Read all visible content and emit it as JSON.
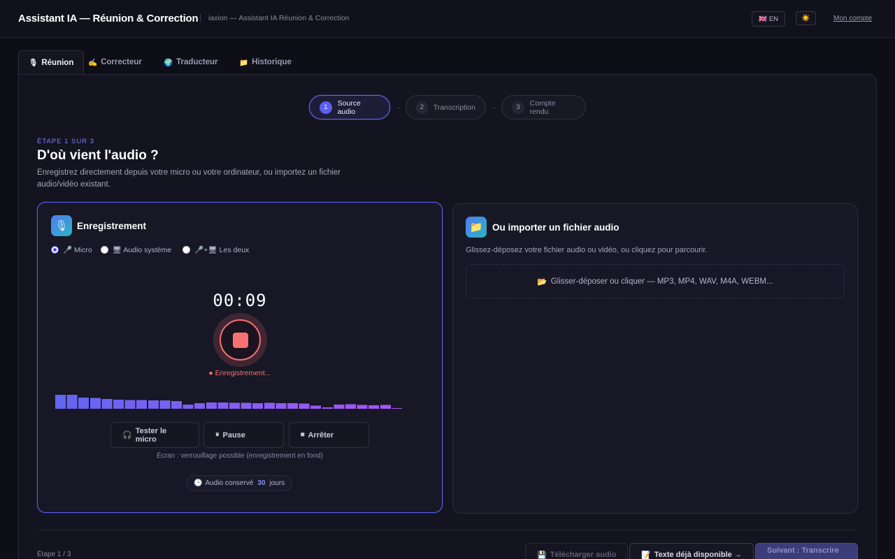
{
  "header": {
    "title": "Assistant IA — Réunion & Correction",
    "subtitle": "iaxion — Assistant IA Réunion & Correction",
    "lang_flag": "🇬🇧",
    "lang_label": "EN",
    "theme_icon": "☀️",
    "account_label": "Mon compte"
  },
  "tabs": [
    {
      "icon": "🎙",
      "label": "Réunion",
      "active": true
    },
    {
      "icon": "✍️",
      "label": "Correcteur",
      "active": false
    },
    {
      "icon": "🌍",
      "label": "Traducteur",
      "active": false
    },
    {
      "icon": "📁",
      "label": "Historique",
      "active": false
    }
  ],
  "stepper": {
    "steps": [
      {
        "num": "1",
        "label": "Source audio",
        "active": true
      },
      {
        "num": "2",
        "label": "Transcription",
        "active": false
      },
      {
        "num": "3",
        "label": "Compte rendu",
        "active": false
      }
    ],
    "arrow": "→"
  },
  "step": {
    "eyebrow": "ÉTAPE 1 SUR 3",
    "title": "D'où vient l'audio ?",
    "description": "Enregistrez directement depuis votre micro ou votre ordinateur, ou importez un fichier audio/vidéo existant."
  },
  "recording": {
    "icon": "🎙",
    "title": "Enregistrement",
    "sources": [
      {
        "label": "🎤 Micro",
        "checked": true
      },
      {
        "label": "🖥 Audio système",
        "checked": false
      },
      {
        "label": "🎤+🖥 Les deux",
        "checked": false
      }
    ],
    "timer": "00:09",
    "status": "● Enregistrement...",
    "levels": [
      0.72,
      0.72,
      0.58,
      0.55,
      0.5,
      0.47,
      0.45,
      0.45,
      0.43,
      0.43,
      0.4,
      0.22,
      0.28,
      0.33,
      0.33,
      0.3,
      0.3,
      0.28,
      0.3,
      0.28,
      0.28,
      0.26,
      0.16,
      0.08,
      0.22,
      0.24,
      0.2,
      0.18,
      0.2,
      0.04
    ],
    "buttons": {
      "test_icon": "🎧",
      "test": "Tester le micro",
      "pause_icon": "⏸",
      "pause": "Pause",
      "stop_icon": "⏹",
      "stop": "Arrêter"
    },
    "hint": "Écran : verrouillage possible (enregistrement en fond)",
    "retention": {
      "icon": "🕒",
      "prefix": "Audio conservé",
      "days": "30",
      "suffix": "jours"
    }
  },
  "import": {
    "icon": "📁",
    "title": "Ou importer un fichier audio",
    "description": "Glissez-déposez votre fichier audio ou vidéo, ou cliquez pour parcourir.",
    "drop_icon": "📂",
    "drop_label": "Glisser-déposer ou cliquer — MP3, MP4, WAV, M4A, WEBM..."
  },
  "footer": {
    "step_count": "Étape 1 / 3",
    "download_icon": "💾",
    "download": "Télécharger audio",
    "text_icon": "📝",
    "text_available": "Texte déjà disponible →",
    "next": "Suivant : Transcrire →"
  },
  "colors": {
    "accent": "#5b5ff0",
    "record": "#f87171",
    "background": "#0e0e17",
    "wave_start": "#6366f1",
    "wave_end": "#a855f7"
  }
}
